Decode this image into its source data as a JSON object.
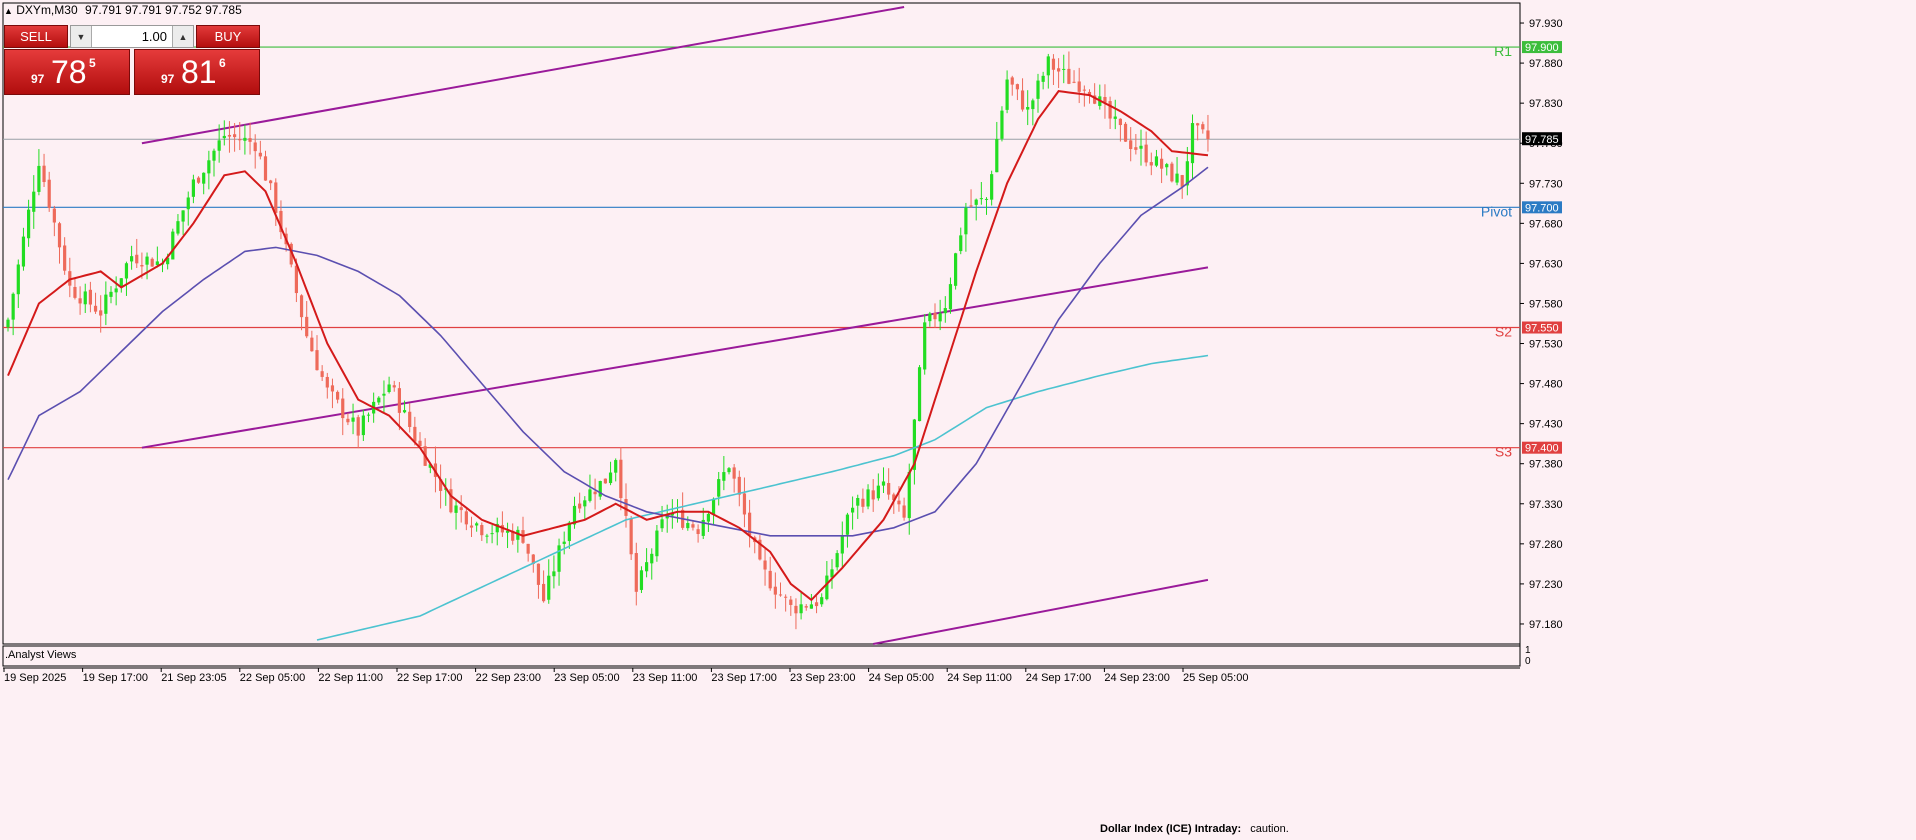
{
  "header": {
    "symbol": "DXYm,M30",
    "ohlc": "97.791 97.791 97.752 97.785"
  },
  "trade_panel": {
    "sell_label": "SELL",
    "buy_label": "BUY",
    "lots": "1.00",
    "sell_price_small": "97",
    "sell_price_big": "78",
    "sell_price_sup": "5",
    "buy_price_small": "97",
    "buy_price_big": "81",
    "buy_price_sup": "6"
  },
  "indicator_panel": {
    "label": ".Analyst Views",
    "scale_top": "1",
    "scale_bottom": "0"
  },
  "footer": {
    "title": "Dollar Index (ICE) Intraday:",
    "text": "caution."
  },
  "colors": {
    "background": "#fdf0f4",
    "bull": "#22dd22",
    "bear": "#ee6a5a",
    "ma_fast": "#d41a1a",
    "ma_mid": "#5b4fb0",
    "ma_slow": "#4cc3d0",
    "channel": "#9a1a9a",
    "r1": "#3cbd3c",
    "pivot": "#2b7bc4",
    "support": "#e04040"
  },
  "chart_data": {
    "type": "candlestick",
    "symbol": "DXYm",
    "timeframe": "M30",
    "current_price": 97.785,
    "ylim": [
      97.155,
      97.955
    ],
    "y_ticks": [
      "97.930",
      "97.880",
      "97.830",
      "97.780",
      "97.730",
      "97.680",
      "97.630",
      "97.580",
      "97.530",
      "97.480",
      "97.430",
      "97.380",
      "97.330",
      "97.280",
      "97.230",
      "97.180"
    ],
    "x_ticks": [
      "19 Sep 2025",
      "19 Sep 17:00",
      "21 Sep 23:05",
      "22 Sep 05:00",
      "22 Sep 11:00",
      "22 Sep 17:00",
      "22 Sep 23:00",
      "23 Sep 05:00",
      "23 Sep 11:00",
      "23 Sep 17:00",
      "23 Sep 23:00",
      "24 Sep 05:00",
      "24 Sep 11:00",
      "24 Sep 17:00",
      "24 Sep 23:00",
      "25 Sep 05:00"
    ],
    "levels": [
      {
        "name": "R1",
        "price": 97.9,
        "label": "97.900"
      },
      {
        "name": "Pivot",
        "price": 97.7,
        "label": "97.700"
      },
      {
        "name": "S2",
        "price": 97.55,
        "label": "97.550"
      },
      {
        "name": "S3",
        "price": 97.4,
        "label": "97.400"
      }
    ],
    "price_marker": "97.785",
    "close_anchors": [
      [
        0,
        97.56
      ],
      [
        6,
        97.76
      ],
      [
        12,
        97.6
      ],
      [
        18,
        97.57
      ],
      [
        24,
        97.64
      ],
      [
        30,
        97.63
      ],
      [
        36,
        97.73
      ],
      [
        42,
        97.79
      ],
      [
        48,
        97.78
      ],
      [
        52,
        97.7
      ],
      [
        58,
        97.54
      ],
      [
        62,
        97.47
      ],
      [
        68,
        97.42
      ],
      [
        74,
        97.48
      ],
      [
        80,
        97.4
      ],
      [
        86,
        97.33
      ],
      [
        92,
        97.3
      ],
      [
        100,
        97.29
      ],
      [
        104,
        97.21
      ],
      [
        110,
        97.33
      ],
      [
        116,
        97.36
      ],
      [
        118,
        97.39
      ],
      [
        122,
        97.22
      ],
      [
        128,
        97.32
      ],
      [
        134,
        97.3
      ],
      [
        140,
        97.38
      ],
      [
        146,
        97.25
      ],
      [
        152,
        97.2
      ],
      [
        158,
        97.21
      ],
      [
        164,
        97.33
      ],
      [
        170,
        97.35
      ],
      [
        174,
        97.31
      ],
      [
        178,
        97.55
      ],
      [
        182,
        97.58
      ],
      [
        186,
        97.7
      ],
      [
        190,
        97.71
      ],
      [
        194,
        97.86
      ],
      [
        198,
        97.82
      ],
      [
        202,
        97.88
      ],
      [
        206,
        97.86
      ],
      [
        210,
        97.85
      ],
      [
        214,
        97.81
      ],
      [
        218,
        97.78
      ],
      [
        222,
        97.76
      ],
      [
        226,
        97.74
      ],
      [
        228,
        97.73
      ],
      [
        230,
        97.795
      ],
      [
        233,
        97.785
      ]
    ],
    "ma_fast_anchors": [
      [
        0,
        97.49
      ],
      [
        6,
        97.58
      ],
      [
        12,
        97.61
      ],
      [
        18,
        97.62
      ],
      [
        22,
        97.6
      ],
      [
        30,
        97.63
      ],
      [
        36,
        97.68
      ],
      [
        42,
        97.74
      ],
      [
        46,
        97.745
      ],
      [
        50,
        97.72
      ],
      [
        56,
        97.63
      ],
      [
        62,
        97.53
      ],
      [
        68,
        97.46
      ],
      [
        74,
        97.44
      ],
      [
        80,
        97.4
      ],
      [
        86,
        97.34
      ],
      [
        92,
        97.31
      ],
      [
        100,
        97.29
      ],
      [
        106,
        97.3
      ],
      [
        112,
        97.31
      ],
      [
        118,
        97.33
      ],
      [
        124,
        97.31
      ],
      [
        130,
        97.32
      ],
      [
        136,
        97.32
      ],
      [
        142,
        97.3
      ],
      [
        148,
        97.27
      ],
      [
        152,
        97.23
      ],
      [
        156,
        97.21
      ],
      [
        162,
        97.25
      ],
      [
        170,
        97.31
      ],
      [
        176,
        97.38
      ],
      [
        182,
        97.5
      ],
      [
        188,
        97.62
      ],
      [
        194,
        97.73
      ],
      [
        200,
        97.81
      ],
      [
        204,
        97.845
      ],
      [
        210,
        97.84
      ],
      [
        216,
        97.82
      ],
      [
        222,
        97.795
      ],
      [
        226,
        97.77
      ],
      [
        233,
        97.765
      ]
    ],
    "ma_mid_anchors": [
      [
        0,
        97.36
      ],
      [
        6,
        97.44
      ],
      [
        14,
        97.47
      ],
      [
        22,
        97.52
      ],
      [
        30,
        97.57
      ],
      [
        38,
        97.61
      ],
      [
        46,
        97.645
      ],
      [
        52,
        97.65
      ],
      [
        60,
        97.64
      ],
      [
        68,
        97.62
      ],
      [
        76,
        97.59
      ],
      [
        84,
        97.54
      ],
      [
        92,
        97.48
      ],
      [
        100,
        97.42
      ],
      [
        108,
        97.37
      ],
      [
        116,
        97.34
      ],
      [
        124,
        97.32
      ],
      [
        132,
        97.31
      ],
      [
        140,
        97.3
      ],
      [
        148,
        97.29
      ],
      [
        156,
        97.29
      ],
      [
        164,
        97.29
      ],
      [
        172,
        97.3
      ],
      [
        180,
        97.32
      ],
      [
        188,
        97.38
      ],
      [
        196,
        97.47
      ],
      [
        204,
        97.56
      ],
      [
        212,
        97.63
      ],
      [
        220,
        97.69
      ],
      [
        228,
        97.725
      ],
      [
        233,
        97.75
      ]
    ],
    "ma_slow_anchors": [
      [
        60,
        97.16
      ],
      [
        80,
        97.19
      ],
      [
        100,
        97.25
      ],
      [
        120,
        97.31
      ],
      [
        140,
        97.34
      ],
      [
        160,
        97.37
      ],
      [
        172,
        97.39
      ],
      [
        180,
        97.41
      ],
      [
        190,
        97.45
      ],
      [
        200,
        97.47
      ],
      [
        212,
        97.49
      ],
      [
        222,
        97.505
      ],
      [
        233,
        97.515
      ]
    ],
    "channel_lines": [
      [
        [
          26,
          97.78
        ],
        [
          174,
          97.95
        ]
      ],
      [
        [
          26,
          97.4
        ],
        [
          233,
          97.625
        ]
      ],
      [
        [
          168,
          97.155
        ],
        [
          233,
          97.235
        ]
      ]
    ]
  }
}
